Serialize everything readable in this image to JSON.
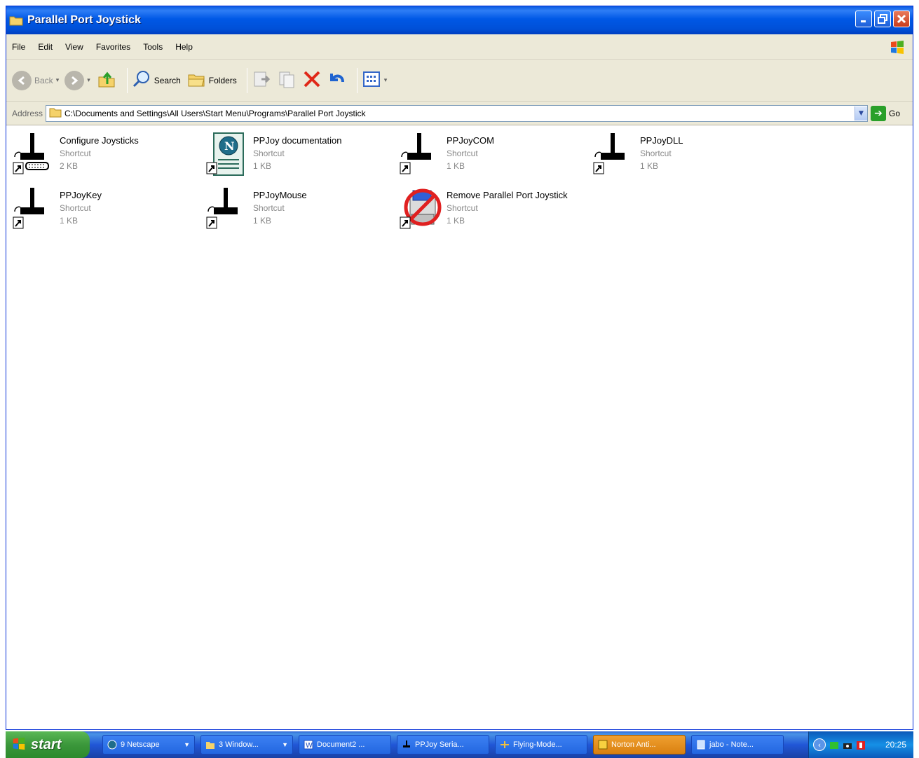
{
  "window": {
    "title": "Parallel Port Joystick"
  },
  "menu": [
    "File",
    "Edit",
    "View",
    "Favorites",
    "Tools",
    "Help"
  ],
  "toolbar": {
    "back": "Back",
    "search": "Search",
    "folders": "Folders"
  },
  "address": {
    "label": "Address",
    "path": "C:\\Documents and Settings\\All Users\\Start Menu\\Programs\\Parallel Port Joystick",
    "go": "Go"
  },
  "items": [
    {
      "name": "Configure Joysticks",
      "type": "Shortcut",
      "size": "2 KB",
      "icon": "joystick-parallel-icon"
    },
    {
      "name": "PPJoy documentation",
      "type": "Shortcut",
      "size": "1 KB",
      "icon": "netscape-document-icon"
    },
    {
      "name": "PPJoyCOM",
      "type": "Shortcut",
      "size": "1 KB",
      "icon": "joystick-icon"
    },
    {
      "name": "PPJoyDLL",
      "type": "Shortcut",
      "size": "1 KB",
      "icon": "joystick-icon"
    },
    {
      "name": "PPJoyKey",
      "type": "Shortcut",
      "size": "1 KB",
      "icon": "joystick-icon"
    },
    {
      "name": "PPJoyMouse",
      "type": "Shortcut",
      "size": "1 KB",
      "icon": "joystick-icon"
    },
    {
      "name": "Remove Parallel Port Joystick",
      "type": "Shortcut",
      "size": "1 KB",
      "icon": "uninstall-icon"
    }
  ],
  "taskbar": {
    "start": "start",
    "tasks": [
      {
        "label": "9 Netscape",
        "icon": "netscape-icon",
        "group": true
      },
      {
        "label": "3 Window...",
        "icon": "folder-icon",
        "group": true
      },
      {
        "label": "Document2 ...",
        "icon": "word-icon",
        "group": false
      },
      {
        "label": "PPJoy Seria...",
        "icon": "joystick-icon",
        "group": false
      },
      {
        "label": "Flying-Mode...",
        "icon": "flying-model-icon",
        "group": false
      },
      {
        "label": "Norton Anti...",
        "icon": "norton-icon",
        "group": false,
        "active": true
      },
      {
        "label": "jabo - Note...",
        "icon": "notepad-icon",
        "group": false
      }
    ],
    "clock": "20:25"
  }
}
